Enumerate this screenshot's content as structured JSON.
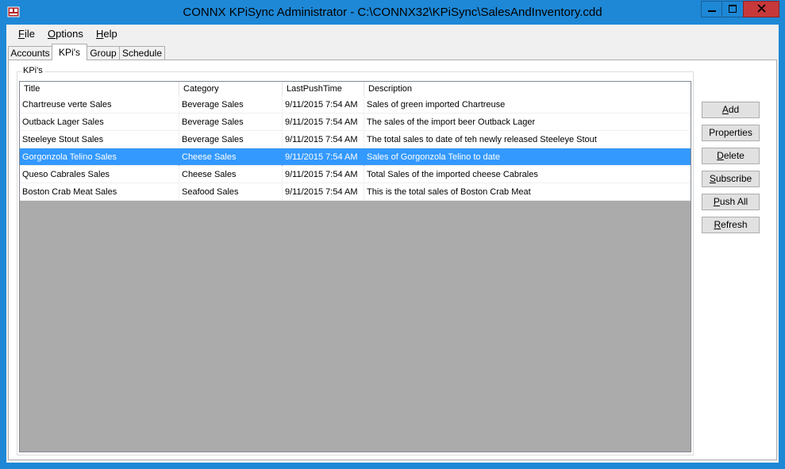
{
  "window": {
    "title": "CONNX KPiSync Administrator - C:\\CONNX32\\KPiSync\\SalesAndInventory.cdd"
  },
  "menu": {
    "file": {
      "mnemonic": "F",
      "rest": "ile"
    },
    "options": {
      "mnemonic": "O",
      "rest": "ptions"
    },
    "help": {
      "mnemonic": "H",
      "rest": "elp"
    }
  },
  "tabs": [
    "Accounts",
    "KPi's",
    "Group",
    "Schedule"
  ],
  "active_tab": 1,
  "group_label": "KPi's",
  "columns": [
    "Title",
    "Category",
    "LastPushTime",
    "Description"
  ],
  "rows": [
    {
      "title": "Chartreuse verte Sales",
      "category": "Beverage Sales",
      "last_push": "9/11/2015 7:54 AM",
      "description": "Sales of green imported Chartreuse"
    },
    {
      "title": "Outback Lager Sales",
      "category": "Beverage Sales",
      "last_push": "9/11/2015 7:54 AM",
      "description": "The sales of the import beer Outback Lager"
    },
    {
      "title": "Steeleye Stout Sales",
      "category": "Beverage Sales",
      "last_push": "9/11/2015 7:54 AM",
      "description": "The total sales to date of teh newly released Steeleye Stout"
    },
    {
      "title": "Gorgonzola Telino Sales",
      "category": "Cheese Sales",
      "last_push": "9/11/2015 7:54 AM",
      "description": "Sales of Gorgonzola Telino to date"
    },
    {
      "title": "Queso Cabrales Sales",
      "category": "Cheese Sales",
      "last_push": "9/11/2015 7:54 AM",
      "description": "Total Sales of the imported cheese Cabrales"
    },
    {
      "title": "Boston Crab Meat Sales",
      "category": "Seafood Sales",
      "last_push": "9/11/2015 7:54 AM",
      "description": "This is the total sales of Boston Crab Meat"
    }
  ],
  "selected_row": 3,
  "buttons": {
    "add": {
      "mnemonic": "A",
      "rest": "dd"
    },
    "properties": {
      "mnemonic": "",
      "rest": "Properties"
    },
    "delete": {
      "mnemonic": "D",
      "rest": "elete"
    },
    "subscribe": {
      "mnemonic": "S",
      "rest": "ubscribe"
    },
    "push_all": {
      "mnemonic": "P",
      "rest": "ush All"
    },
    "refresh": {
      "mnemonic": "R",
      "rest": "efresh"
    }
  },
  "colors": {
    "titlebar": "#1e88d6",
    "selection": "#3399ff",
    "listview_empty": "#ababab",
    "close_button": "#c7383a"
  },
  "icons": {
    "app": "app-icon",
    "minimize": "minimize-icon",
    "maximize": "maximize-icon",
    "close": "close-icon"
  }
}
